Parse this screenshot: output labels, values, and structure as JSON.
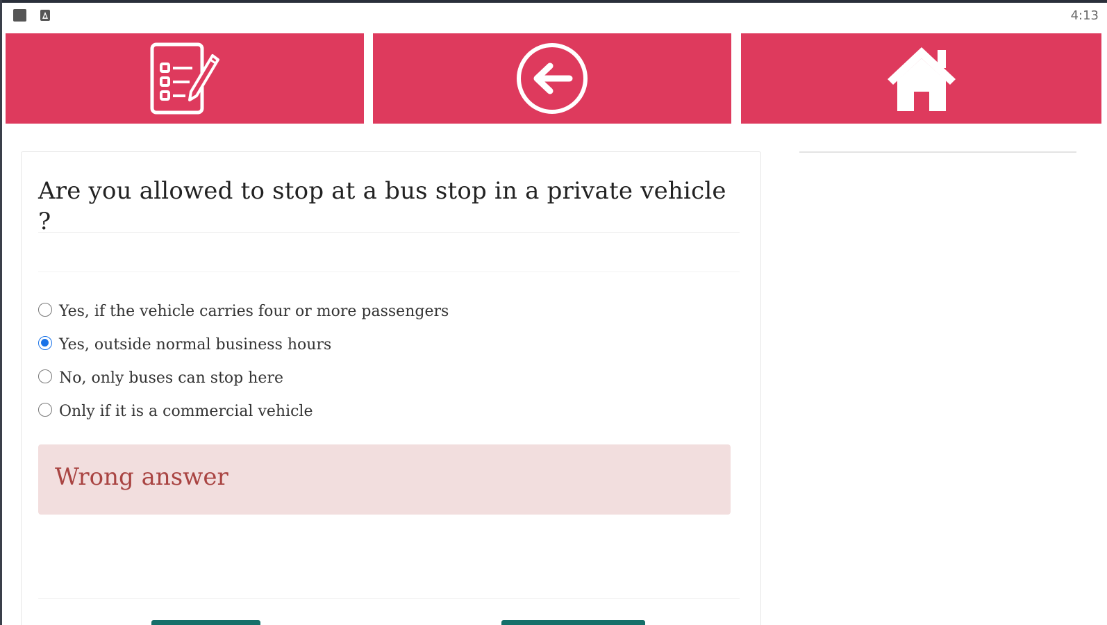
{
  "status_bar": {
    "time": "4:13",
    "icons": [
      "notification-square-icon",
      "app-notification-icon"
    ]
  },
  "nav": {
    "color": "#de3a5d",
    "buttons": [
      {
        "icon": "checklist-pencil-icon"
      },
      {
        "icon": "back-arrow-circle-icon"
      },
      {
        "icon": "home-icon"
      }
    ]
  },
  "quiz": {
    "question": "Are you allowed to stop at a bus stop in a private vehicle ?",
    "options": [
      {
        "label": "Yes, if the vehicle carries four or more passengers",
        "selected": false
      },
      {
        "label": "Yes, outside normal business hours",
        "selected": true
      },
      {
        "label": "No, only buses can stop here",
        "selected": false
      },
      {
        "label": "Only if it is a commercial vehicle",
        "selected": false
      }
    ],
    "result": "Wrong answer",
    "result_color": "#a94442",
    "result_bg": "#f2dede"
  },
  "colors": {
    "radio_selected": "#1a73e8",
    "bottom_buttons": "#15706a"
  }
}
